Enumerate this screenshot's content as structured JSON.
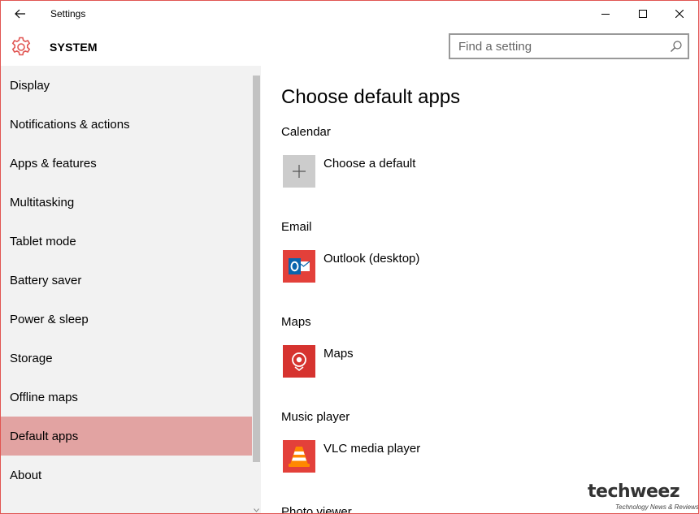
{
  "window": {
    "title": "Settings",
    "accent": "#e15552"
  },
  "header": {
    "section": "SYSTEM",
    "search": {
      "placeholder": "Find a setting",
      "value": ""
    }
  },
  "sidebar": {
    "items": [
      {
        "label": "Display",
        "selected": false
      },
      {
        "label": "Notifications & actions",
        "selected": false
      },
      {
        "label": "Apps & features",
        "selected": false
      },
      {
        "label": "Multitasking",
        "selected": false
      },
      {
        "label": "Tablet mode",
        "selected": false
      },
      {
        "label": "Battery saver",
        "selected": false
      },
      {
        "label": "Power & sleep",
        "selected": false
      },
      {
        "label": "Storage",
        "selected": false
      },
      {
        "label": "Offline maps",
        "selected": false
      },
      {
        "label": "Default apps",
        "selected": true
      },
      {
        "label": "About",
        "selected": false
      }
    ]
  },
  "main": {
    "title": "Choose default apps",
    "categories": [
      {
        "label": "Calendar",
        "app": "Choose a default",
        "icon": "plus-icon"
      },
      {
        "label": "Email",
        "app": "Outlook (desktop)",
        "icon": "outlook-icon"
      },
      {
        "label": "Maps",
        "app": "Maps",
        "icon": "maps-icon"
      },
      {
        "label": "Music player",
        "app": "VLC media player",
        "icon": "vlc-icon"
      },
      {
        "label": "Photo viewer"
      }
    ]
  },
  "watermark": {
    "logo": "techweez",
    "tagline": "Technology News & Reviews"
  }
}
